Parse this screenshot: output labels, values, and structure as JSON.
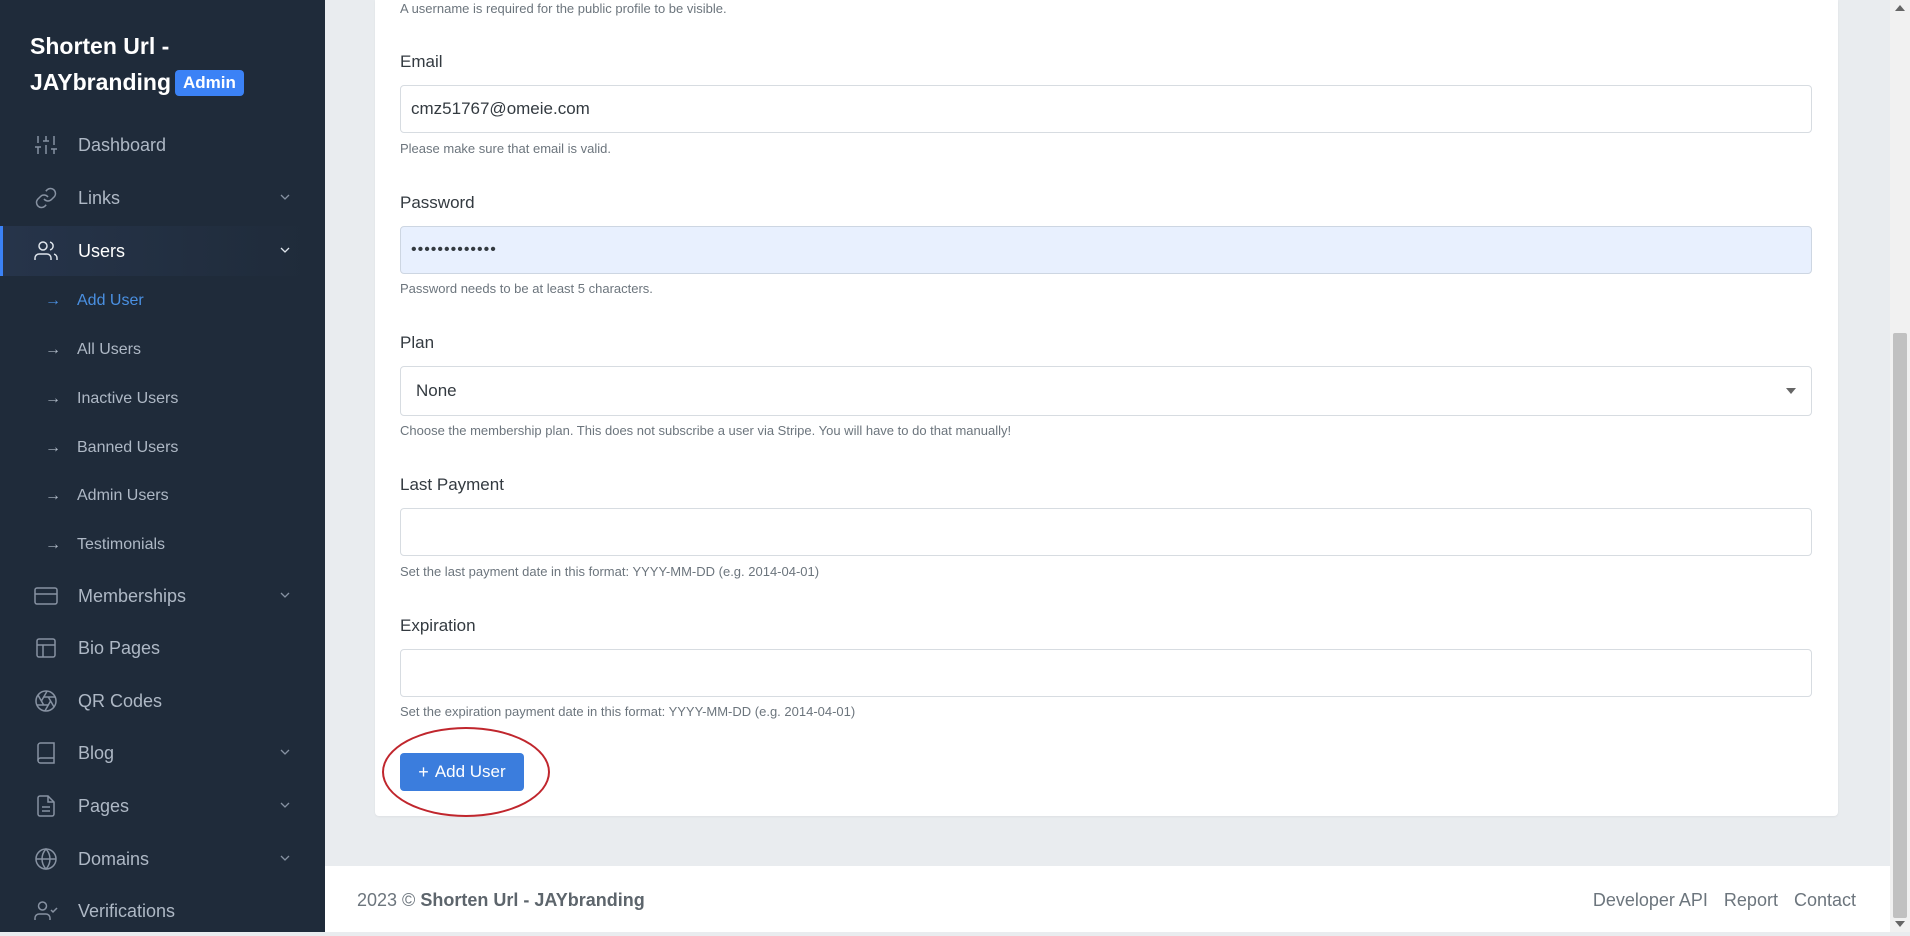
{
  "sidebar": {
    "brand_line1": "Shorten Url -",
    "brand_line2": "JAYbranding",
    "badge": "Admin",
    "items": [
      {
        "label": "Dashboard"
      },
      {
        "label": "Links"
      },
      {
        "label": "Users"
      },
      {
        "label": "Memberships"
      },
      {
        "label": "Bio Pages"
      },
      {
        "label": "QR Codes"
      },
      {
        "label": "Blog"
      },
      {
        "label": "Pages"
      },
      {
        "label": "Domains"
      },
      {
        "label": "Verifications"
      }
    ],
    "sub_items": [
      {
        "label": "Add User"
      },
      {
        "label": "All Users"
      },
      {
        "label": "Inactive Users"
      },
      {
        "label": "Banned Users"
      },
      {
        "label": "Admin Users"
      },
      {
        "label": "Testimonials"
      }
    ]
  },
  "form": {
    "username_help": "A username is required for the public profile to be visible.",
    "email_label": "Email",
    "email_value": "cmz51767@omeie.com",
    "email_help": "Please make sure that email is valid.",
    "password_label": "Password",
    "password_value": "•••••••••••••",
    "password_help": "Password needs to be at least 5 characters.",
    "plan_label": "Plan",
    "plan_value": "None",
    "plan_help": "Choose the membership plan. This does not subscribe a user via Stripe. You will have to do that manually!",
    "last_payment_label": "Last Payment",
    "last_payment_value": "",
    "last_payment_help": "Set the last payment date in this format: YYYY-MM-DD (e.g. 2014-04-01)",
    "expiration_label": "Expiration",
    "expiration_value": "",
    "expiration_help": "Set the expiration payment date in this format: YYYY-MM-DD (e.g. 2014-04-01)",
    "submit_label": "Add User"
  },
  "footer": {
    "copy_prefix": "2023 ©",
    "copy_brand": "Shorten Url - JAYbranding",
    "links": [
      "Developer API",
      "Report",
      "Contact"
    ]
  },
  "colors": {
    "sidebar_bg": "#1f2b3a",
    "accent": "#3b7ddd",
    "highlight_circle": "#c0262d"
  }
}
